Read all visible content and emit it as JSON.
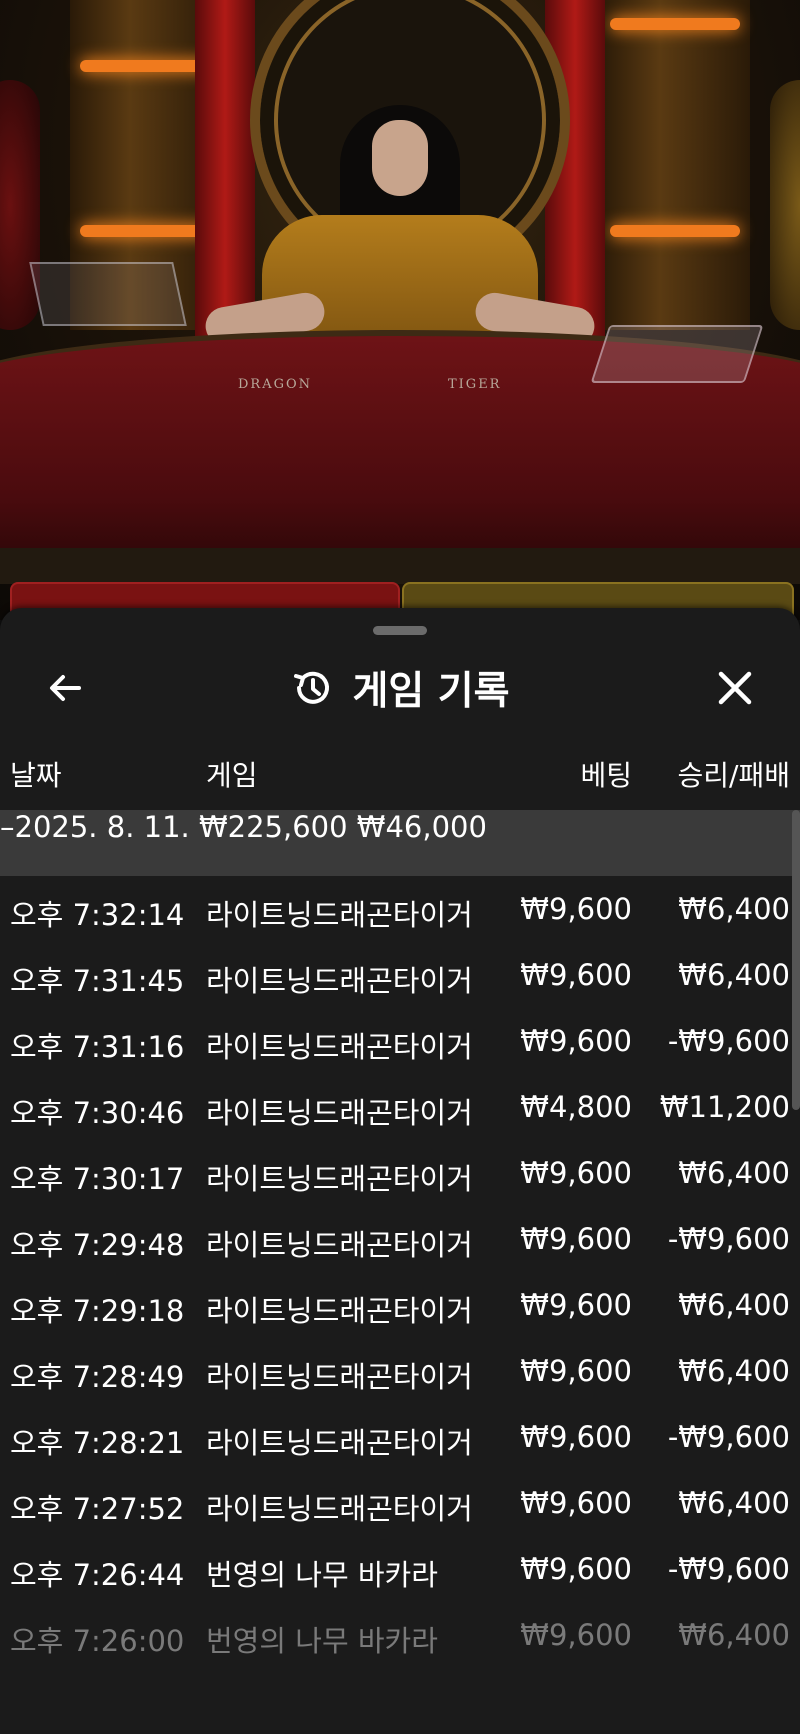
{
  "stream": {
    "table_left_label": "DRAGON",
    "table_right_label": "TIGER"
  },
  "history": {
    "title": "게임 기록",
    "columns": {
      "date": "날짜",
      "game": "게임",
      "bet": "베팅",
      "result": "승리/패배"
    },
    "day_group": {
      "date": "–2025. 8. 11.",
      "bet_total": "₩225,600",
      "result_total": "₩46,000"
    },
    "rows": [
      {
        "time": "오후 7:32:14",
        "game": "라이트닝드래곤타이거",
        "bet": "₩9,600",
        "result": "₩6,400"
      },
      {
        "time": "오후 7:31:45",
        "game": "라이트닝드래곤타이거",
        "bet": "₩9,600",
        "result": "₩6,400"
      },
      {
        "time": "오후 7:31:16",
        "game": "라이트닝드래곤타이거",
        "bet": "₩9,600",
        "result": "-₩9,600"
      },
      {
        "time": "오후 7:30:46",
        "game": "라이트닝드래곤타이거",
        "bet": "₩4,800",
        "result": "₩11,200"
      },
      {
        "time": "오후 7:30:17",
        "game": "라이트닝드래곤타이거",
        "bet": "₩9,600",
        "result": "₩6,400"
      },
      {
        "time": "오후 7:29:48",
        "game": "라이트닝드래곤타이거",
        "bet": "₩9,600",
        "result": "-₩9,600"
      },
      {
        "time": "오후 7:29:18",
        "game": "라이트닝드래곤타이거",
        "bet": "₩9,600",
        "result": "₩6,400"
      },
      {
        "time": "오후 7:28:49",
        "game": "라이트닝드래곤타이거",
        "bet": "₩9,600",
        "result": "₩6,400"
      },
      {
        "time": "오후 7:28:21",
        "game": "라이트닝드래곤타이거",
        "bet": "₩9,600",
        "result": "-₩9,600"
      },
      {
        "time": "오후 7:27:52",
        "game": "라이트닝드래곤타이거",
        "bet": "₩9,600",
        "result": "₩6,400"
      },
      {
        "time": "오후 7:26:44",
        "game": "번영의 나무 바카라",
        "bet": "₩9,600",
        "result": "-₩9,600"
      },
      {
        "time": "오후 7:26:00",
        "game": "번영의 나무 바카라",
        "bet": "₩9,600",
        "result": "₩6,400"
      }
    ]
  },
  "icons": {
    "back": "arrow-left-icon",
    "history": "history-clock-icon",
    "close": "close-icon"
  }
}
